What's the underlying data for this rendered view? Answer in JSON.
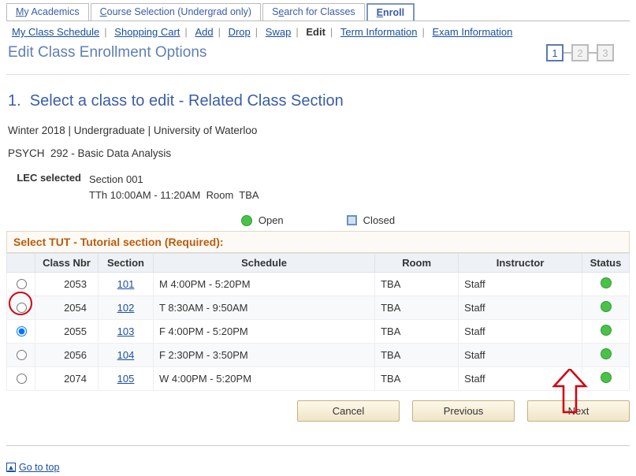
{
  "tabs": [
    {
      "pre": "",
      "u": "M",
      "post": "y Academics"
    },
    {
      "pre": "",
      "u": "C",
      "post": "ourse Selection (Undergrad only)"
    },
    {
      "pre": "S",
      "u": "e",
      "post": "arch for Classes"
    },
    {
      "pre": "",
      "u": "E",
      "post": "nroll"
    }
  ],
  "subnav": {
    "items": [
      "My Class Schedule",
      "Shopping Cart",
      "Add",
      "Drop",
      "Swap",
      "Edit",
      "Term Information",
      "Exam Information"
    ],
    "current_index": 5
  },
  "page_title": "Edit Class Enrollment Options",
  "steps": [
    "1",
    "2",
    "3"
  ],
  "section_title": "1.  Select a class to edit - Related Class Section",
  "term_line": "Winter 2018 | Undergraduate | University of Waterloo",
  "course_line": "PSYCH  292 - Basic Data Analysis",
  "lec": {
    "label": "LEC selected",
    "section": "Section 001",
    "schedule": "TTh 10:00AM - 11:20AM  Room  TBA"
  },
  "legend": {
    "open": "Open",
    "closed": "Closed"
  },
  "tut": {
    "caption": "Select TUT - Tutorial section (Required):",
    "headers": [
      "Class Nbr",
      "Section",
      "Schedule",
      "Room",
      "Instructor",
      "Status"
    ],
    "rows": [
      {
        "class_nbr": "2053",
        "section": "101",
        "schedule": "M 4:00PM - 5:20PM",
        "room": "TBA",
        "instructor": "Staff",
        "status": "open",
        "selected": false
      },
      {
        "class_nbr": "2054",
        "section": "102",
        "schedule": "T 8:30AM - 9:50AM",
        "room": "TBA",
        "instructor": "Staff",
        "status": "open",
        "selected": false
      },
      {
        "class_nbr": "2055",
        "section": "103",
        "schedule": "F 4:00PM - 5:20PM",
        "room": "TBA",
        "instructor": "Staff",
        "status": "open",
        "selected": true
      },
      {
        "class_nbr": "2056",
        "section": "104",
        "schedule": "F 2:30PM - 3:50PM",
        "room": "TBA",
        "instructor": "Staff",
        "status": "open",
        "selected": false
      },
      {
        "class_nbr": "2074",
        "section": "105",
        "schedule": "W 4:00PM - 5:20PM",
        "room": "TBA",
        "instructor": "Staff",
        "status": "open",
        "selected": false
      }
    ]
  },
  "buttons": {
    "cancel": "Cancel",
    "previous": "Previous",
    "next": "Next"
  },
  "go_top": "Go to top"
}
